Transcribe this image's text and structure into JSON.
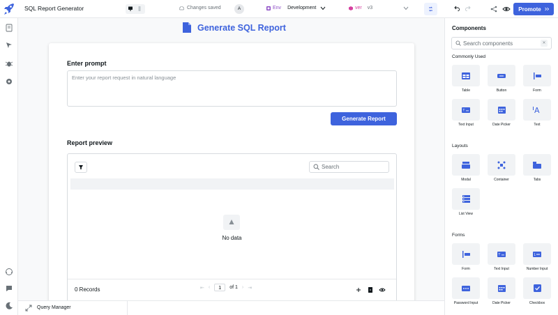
{
  "topbar": {
    "app_name": "SQL Report Generator",
    "saved_status": "Changes saved",
    "avatar_initial": "A",
    "env_tag": "Env",
    "env_value": "Development",
    "ver_tag": "ver",
    "ver_value": "v3",
    "promote_label": "Promote"
  },
  "page": {
    "title": "Generate SQL Report",
    "prompt_label": "Enter prompt",
    "prompt_placeholder": "Enter your report request in natural language",
    "prompt_value": "",
    "generate_label": "Generate Report",
    "preview_label": "Report preview",
    "table": {
      "search_placeholder": "Search",
      "empty_text": "No data",
      "records_text": "0 Records",
      "page_number": "1",
      "page_of": "of 1"
    }
  },
  "query_manager": {
    "label": "Query Manager"
  },
  "components_panel": {
    "title": "Components",
    "search_placeholder": "Search components",
    "sections": [
      {
        "title": "Commonly Used",
        "items": [
          "Table",
          "Button",
          "Form",
          "Text Input",
          "Date Picker",
          "Text"
        ]
      },
      {
        "title": "Layouts",
        "items": [
          "Modal",
          "Container",
          "Tabs",
          "List View"
        ]
      },
      {
        "title": "Forms",
        "items": [
          "Form",
          "Text Input",
          "Number Input",
          "Password Input",
          "Date Picker",
          "Checkbox"
        ]
      }
    ]
  },
  "colors": {
    "accent": "#3e63dd",
    "env_tag": "#8e4ec6",
    "ver_tag": "#d6409f",
    "canvas_bg": "#f8f9fa"
  }
}
